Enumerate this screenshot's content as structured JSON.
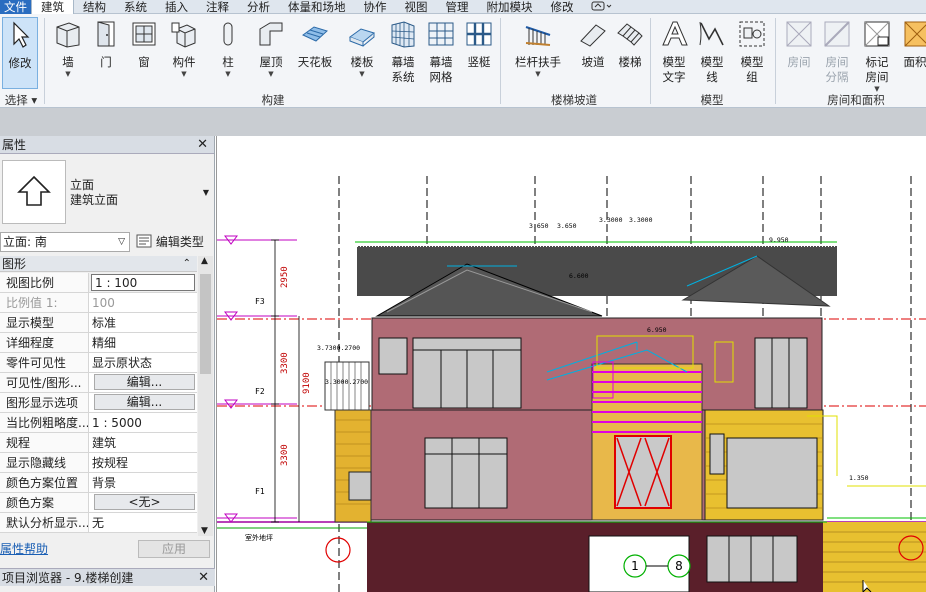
{
  "tabs": [
    "文件",
    "建筑",
    "结构",
    "系统",
    "插入",
    "注释",
    "分析",
    "体量和场地",
    "协作",
    "视图",
    "管理",
    "附加模块",
    "修改"
  ],
  "active_tab": "建筑",
  "ribbon": {
    "modify": "修改",
    "wall": "墙",
    "door": "门",
    "window": "窗",
    "component": "构件",
    "column": "柱",
    "roof": "屋顶",
    "ceiling": "天花板",
    "floor": "楼板",
    "curtain_system_1": "幕墙",
    "curtain_system_2": "系统",
    "curtain_grid_1": "幕墙",
    "curtain_grid_2": "网格",
    "mullion": "竖梃",
    "railing": "栏杆扶手",
    "ramp": "坡道",
    "stair": "楼梯",
    "model_text_1": "模型",
    "model_text_2": "文字",
    "model_line_1": "模型",
    "model_line_2": "线",
    "model_group_1": "模型",
    "model_group_2": "组",
    "room": "房间",
    "room_sep_1": "房间",
    "room_sep_2": "分隔",
    "tag_room_1": "标记",
    "tag_room_2": "房间",
    "area": "面积",
    "groups": {
      "select": "选择",
      "build": "构建",
      "circulation": "楼梯坡道",
      "model": "模型",
      "room_area": "房间和面积"
    }
  },
  "properties": {
    "title": "属性",
    "type_line1": "立面",
    "type_line2": "建筑立面",
    "view_selector": "立面: 南",
    "edit_type": "编辑类型",
    "section": "图形",
    "rows": [
      {
        "k": "视图比例",
        "v": "1 : 100"
      },
      {
        "k": "比例值 1:",
        "v": "100"
      },
      {
        "k": "显示模型",
        "v": "标准"
      },
      {
        "k": "详细程度",
        "v": "精细"
      },
      {
        "k": "零件可见性",
        "v": "显示原状态"
      },
      {
        "k": "可见性/图形...",
        "v": "编辑..."
      },
      {
        "k": "图形显示选项",
        "v": "编辑..."
      },
      {
        "k": "当比例粗略度...",
        "v": "1 : 5000"
      },
      {
        "k": "规程",
        "v": "建筑"
      },
      {
        "k": "显示隐藏线",
        "v": "按规程"
      },
      {
        "k": "颜色方案位置",
        "v": "背景"
      },
      {
        "k": "颜色方案",
        "v": "<无>"
      },
      {
        "k": "默认分析显示...",
        "v": "无"
      }
    ],
    "help": "属性帮助",
    "apply": "应用"
  },
  "browser_title": "项目浏览器 - 9.楼梯创建",
  "drawing": {
    "levels": [
      "F3",
      "F2",
      "F1"
    ],
    "dims": [
      "2950",
      "3300",
      "3300",
      "9100"
    ],
    "grid_labels": [
      "1",
      "8"
    ],
    "elevation_tags": [
      "3.650",
      "3.650",
      "3.3000",
      "3.3000",
      "9.950",
      "6.600",
      "6.950",
      "3.7300.2700",
      "3.3000.2700",
      "3.300",
      "1.350"
    ],
    "ground_label": "室外地坪"
  }
}
